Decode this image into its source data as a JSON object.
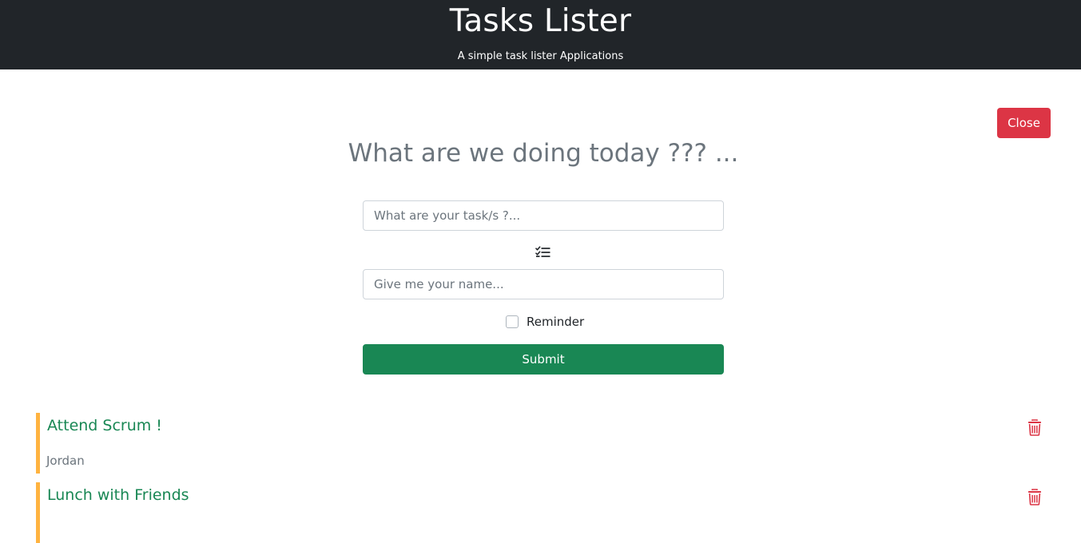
{
  "header": {
    "title": "Tasks Lister",
    "subtitle": "A simple task lister Applications"
  },
  "close_button": {
    "label": "Close"
  },
  "form": {
    "heading": "What are we doing today ??? ...",
    "task_placeholder": "What are your task/s ?...",
    "task_value": "",
    "list_icon": "list-check-icon",
    "name_placeholder": "Give me your name...",
    "name_value": "",
    "reminder_label": "Reminder",
    "reminder_checked": false,
    "submit_label": "Submit"
  },
  "tasks": [
    {
      "title": "Attend Scrum !",
      "owner": "Jordan",
      "delete_icon": "trash-icon"
    },
    {
      "title": "Lunch with Friends",
      "owner": "",
      "delete_icon": "trash-icon"
    }
  ],
  "colors": {
    "header_bg": "#212529",
    "danger": "#dc3545",
    "success": "#198754",
    "reminder_border": "#ffb340",
    "muted": "#6c757d"
  }
}
